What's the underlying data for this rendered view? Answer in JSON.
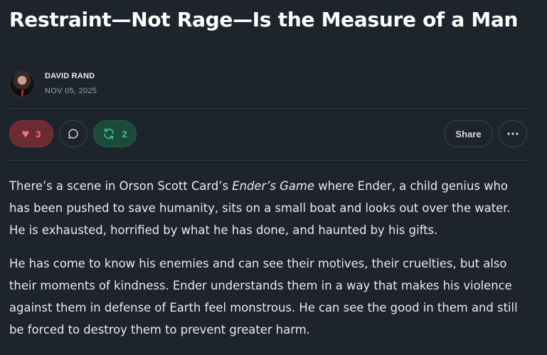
{
  "article": {
    "title": "Restraint—Not Rage—Is the Measure of a Man",
    "author": "DAVID RAND",
    "date": "NOV 05, 2025"
  },
  "actions": {
    "like_count": "3",
    "restack_count": "2",
    "share_label": "Share"
  },
  "body": {
    "p1_before": "There’s a scene in Orson Scott Card’s ",
    "p1_italic": "Ender’s Game",
    "p1_after": " where Ender, a child genius who has been pushed to save humanity, sits on a small boat and looks out over the water. He is exhausted, horrified by what he has done, and haunted by his gifts.",
    "p2": "He has come to know his enemies and can see their motives, their cruelties, but also their moments of kindness. Ender understands them in a way that makes his violence against them in defense of Earth feel monstrous. He can see the good in them and still be forced to destroy them to prevent greater harm."
  },
  "colors": {
    "background": "#1d242c",
    "like_accent": "#f2727d",
    "restack_accent": "#36c88a"
  },
  "icons": {
    "like": "heart-icon",
    "comment": "comment-bubble-icon",
    "restack": "restack-icon",
    "more": "ellipsis-icon"
  }
}
